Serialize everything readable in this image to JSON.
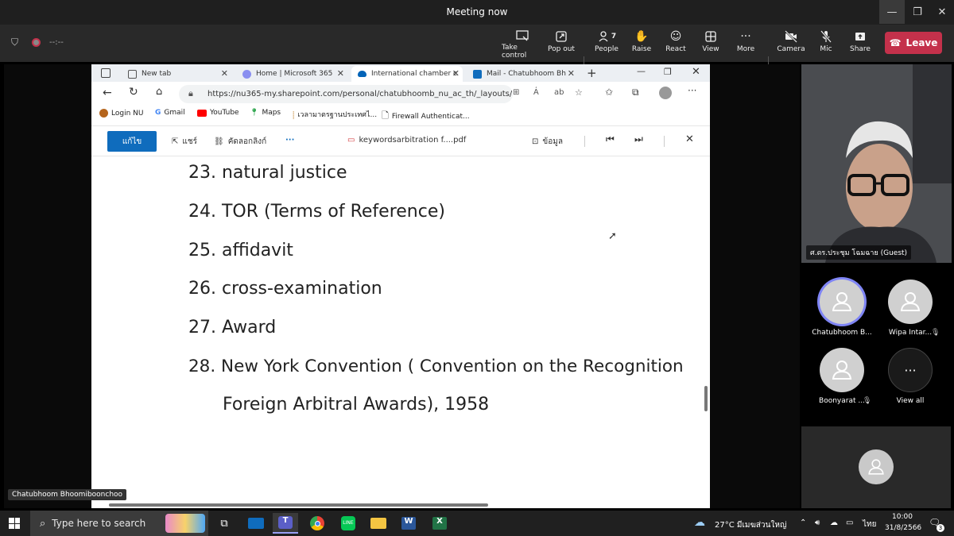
{
  "window": {
    "title": "Meeting now",
    "timer": "--:--"
  },
  "toolbar": {
    "take_control": "Take control",
    "pop_out": "Pop out",
    "people": "People",
    "people_count": "7",
    "raise": "Raise",
    "react": "React",
    "view": "View",
    "more": "More",
    "camera": "Camera",
    "mic": "Mic",
    "share": "Share",
    "leave": "Leave"
  },
  "browser": {
    "tabs": [
      {
        "label": "New tab"
      },
      {
        "label": "Home | Microsoft 365"
      },
      {
        "label": "International chamber c"
      },
      {
        "label": "Mail - Chatubhoom Bh"
      }
    ],
    "url": "https://nu365-my.sharepoint.com/personal/chatubhoomb_nu_ac_th/_layouts/...",
    "bookmarks": [
      {
        "label": "Login NU"
      },
      {
        "label": "Gmail"
      },
      {
        "label": "YouTube"
      },
      {
        "label": "Maps"
      },
      {
        "label": "เวลามาตรฐานประเทศไ..."
      },
      {
        "label": "Firewall Authenticat..."
      }
    ]
  },
  "sharepoint": {
    "edit": "แก้ไข",
    "share": "แชร์",
    "copy_link": "คัดลอกลิงก์",
    "more": "···",
    "filename": "keywordsarbitration f....pdf",
    "info": "ข้อมูล"
  },
  "pdf_lines": [
    "23. natural justice",
    "24. TOR (Terms of Reference)",
    "25. affidavit",
    "26. cross-examination",
    "27. Award",
    "28. New York Convention ( Convention on the Recognition",
    "Foreign Arbitral Awards), 1958"
  ],
  "participants": {
    "video_name": "ศ.ดร.ประชุม โฉมฉาย (Guest)",
    "list": [
      {
        "name": "Chatubhoom B..."
      },
      {
        "name": "Wipa Intar..."
      },
      {
        "name": "Boonyarat ..."
      },
      {
        "name": "View all"
      }
    ],
    "self_name": "Chatubhoom Bhoomiboonchoo"
  },
  "taskbar": {
    "search_placeholder": "Type here to search",
    "weather": "27°C มีเมฆส่วนใหญ่",
    "lang": "ไทย",
    "time": "10:00",
    "date": "31/8/2566",
    "notifications": "3"
  },
  "colors": {
    "leave": "#c4314b",
    "edit_button": "#0f6cbd",
    "avatar_ring": "#7f85f5"
  }
}
